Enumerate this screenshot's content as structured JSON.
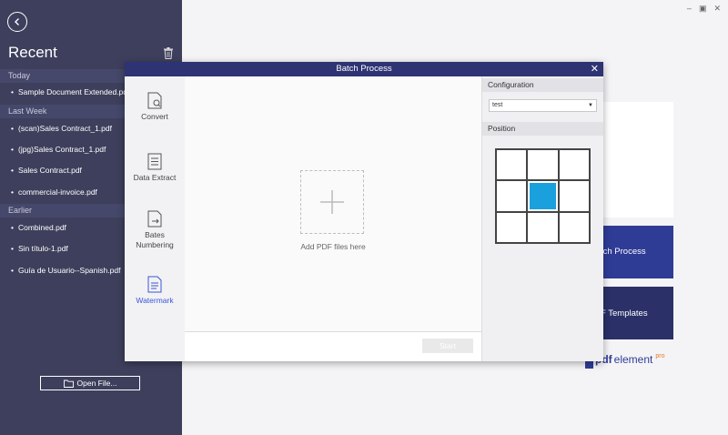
{
  "sidebar": {
    "title": "Recent",
    "sections": [
      {
        "label": "Today",
        "items": [
          "Sample Document Extended.pdf"
        ]
      },
      {
        "label": "Last Week",
        "items": [
          "(scan)Sales Contract_1.pdf",
          "(jpg)Sales Contract_1.pdf",
          "Sales Contract.pdf",
          "commercial-invoice.pdf"
        ]
      },
      {
        "label": "Earlier",
        "items": [
          "Combined.pdf",
          "Sin título-1.pdf",
          "Guía de Usuario--Spanish.pdf"
        ]
      }
    ],
    "open_file_label": "Open File..."
  },
  "background": {
    "batch_process_label": "tch Process",
    "templates_label": "F Templates",
    "brand": {
      "pdf": "pdf",
      "element": "element",
      "pro": "pro"
    }
  },
  "dialog": {
    "title": "Batch Process",
    "nav": [
      {
        "label": "Convert",
        "icon": "convert-icon"
      },
      {
        "label": "Data Extract",
        "icon": "data-extract-icon"
      },
      {
        "label": "Bates Numbering",
        "icon": "bates-numbering-icon"
      },
      {
        "label": "Watermark",
        "icon": "watermark-icon",
        "active": true
      }
    ],
    "drop_label": "Add PDF files here",
    "start_label": "Start",
    "configuration": {
      "heading": "Configuration",
      "value": "test"
    },
    "position": {
      "heading": "Position",
      "selected_row": 1,
      "selected_col": 1
    }
  },
  "colors": {
    "sidebar": "#3d3f5c",
    "titlebar": "#2e3373",
    "accent": "#1aa0dc",
    "active_nav": "#3a56d6"
  }
}
